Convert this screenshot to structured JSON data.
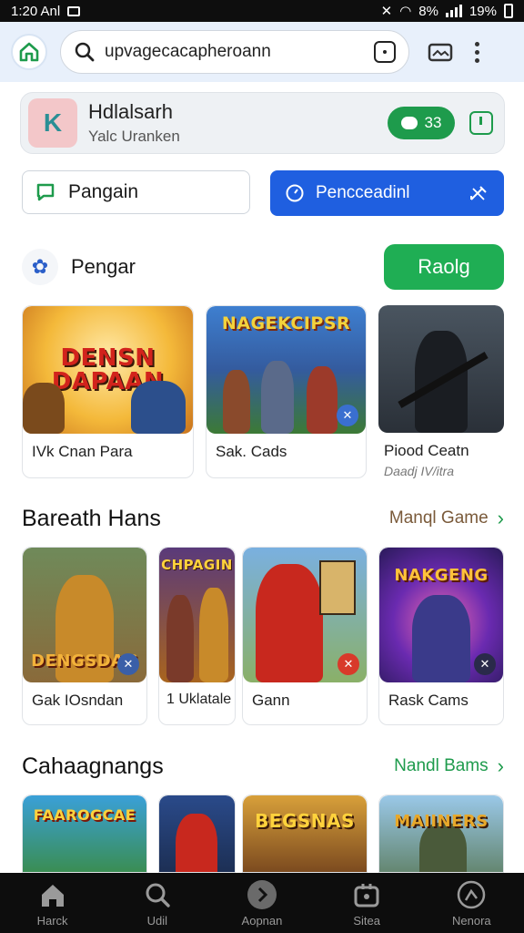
{
  "status_bar": {
    "time": "1:20 Anl",
    "battery": "19%",
    "signal_text": "8%"
  },
  "url_bar": {
    "url": "upvagecacapheroann"
  },
  "app_card": {
    "title": "Hdlalsarh",
    "subtitle": "Yalc Uranken",
    "chat_count": "33"
  },
  "tabs": {
    "left_label": "Pangain",
    "right_label": "Pencceadinl"
  },
  "section1": {
    "title": "Pengar",
    "button": "Raolg"
  },
  "featured": [
    {
      "art": "DENSN DAPAAN",
      "caption": "IVk Cnan Para",
      "caption2": ""
    },
    {
      "art": "NAGEKCIPSR",
      "caption": "Sak. Cads",
      "caption2": ""
    },
    {
      "art": "",
      "caption": "Piood Ceatn",
      "caption2": "Daadj IV/itra"
    }
  ],
  "section2": {
    "title": "Bareath Hans",
    "more": "Manql Game"
  },
  "row2": [
    {
      "art": "DENGSDAG",
      "caption": "Gak IOsndan"
    },
    {
      "art": "CHPAGIN",
      "caption": "1 Uklatale"
    },
    {
      "art": "",
      "caption": "Gann"
    },
    {
      "art": "NAKGENG",
      "caption": "Rask Cams"
    }
  ],
  "section3": {
    "title": "Cahaagnangs",
    "more": "Nandl Bams"
  },
  "row3": [
    {
      "art": "FAAROGCAE"
    },
    {
      "art": ""
    },
    {
      "art": "BEGSNAS"
    },
    {
      "art": "MAIINERS"
    }
  ],
  "bottom_nav": [
    {
      "label": "Harck",
      "icon": "home-icon"
    },
    {
      "label": "Udil",
      "icon": "search-icon"
    },
    {
      "label": "Aopnan",
      "icon": "play-icon"
    },
    {
      "label": "Sitea",
      "icon": "store-icon"
    },
    {
      "label": "Nenora",
      "icon": "profile-icon"
    }
  ],
  "colors": {
    "accent_blue": "#1f5fe0",
    "accent_green": "#1fae54",
    "nav_bg": "#0d0d0d"
  }
}
